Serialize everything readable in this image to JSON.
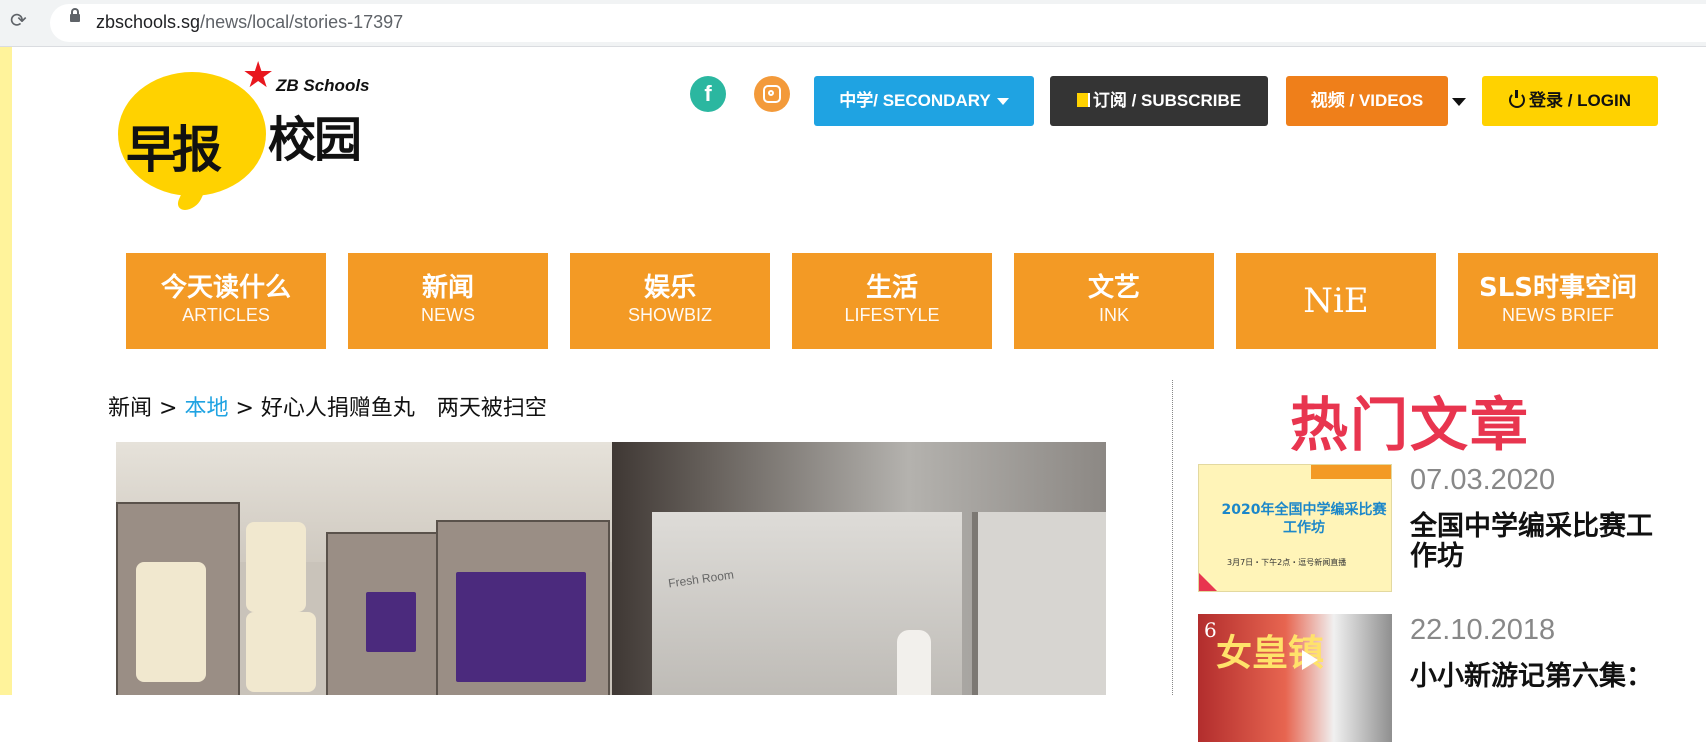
{
  "browser": {
    "url_domain": "zbschools.sg",
    "url_path": "/news/local/stories-17397"
  },
  "logo": {
    "brand_en": "ZB Schools",
    "brand_cn_1": "早报",
    "brand_cn_2": "校园"
  },
  "header": {
    "secondary_label": "中学/ SECONDARY",
    "subscribe_label": "订阅 / SUBSCRIBE",
    "videos_label": "视频 / VIDEOS",
    "login_label": "登录 / LOGIN"
  },
  "nav": {
    "items": [
      {
        "cn": "今天读什么",
        "en": "ARTICLES"
      },
      {
        "cn": "新闻",
        "en": "NEWS"
      },
      {
        "cn": "娱乐",
        "en": "SHOWBIZ"
      },
      {
        "cn": "生活",
        "en": "LIFESTYLE"
      },
      {
        "cn": "文艺",
        "en": "INK"
      },
      {
        "cn": "NiE",
        "en": ""
      },
      {
        "cn": "SLS时事空间",
        "en": "NEWS BRIEF"
      }
    ]
  },
  "breadcrumb": {
    "section": "新闻",
    "sep": " > ",
    "subsection": "本地",
    "article": "好心人捐赠鱼丸　两天被扫空"
  },
  "photo": {
    "label": "Fresh Room"
  },
  "sidebar": {
    "title": "热门文章",
    "cards": [
      {
        "date": "07.03.2020",
        "title": "全国中学编采比赛工作坊",
        "thumb_text": "2020年全国中学编采比赛工作坊",
        "thumb_sub": "3月7日・下午2点・逗号新闻直播"
      },
      {
        "date": "22.10.2018",
        "title": "小小新游记第六集：",
        "thumb_num": "6",
        "thumb_text": "女皇镇"
      }
    ]
  },
  "colors": {
    "nav_orange": "#f39a25",
    "secondary_blue": "#1fa3e2",
    "hot_red": "#e8354f",
    "login_yellow": "#ffd200"
  }
}
